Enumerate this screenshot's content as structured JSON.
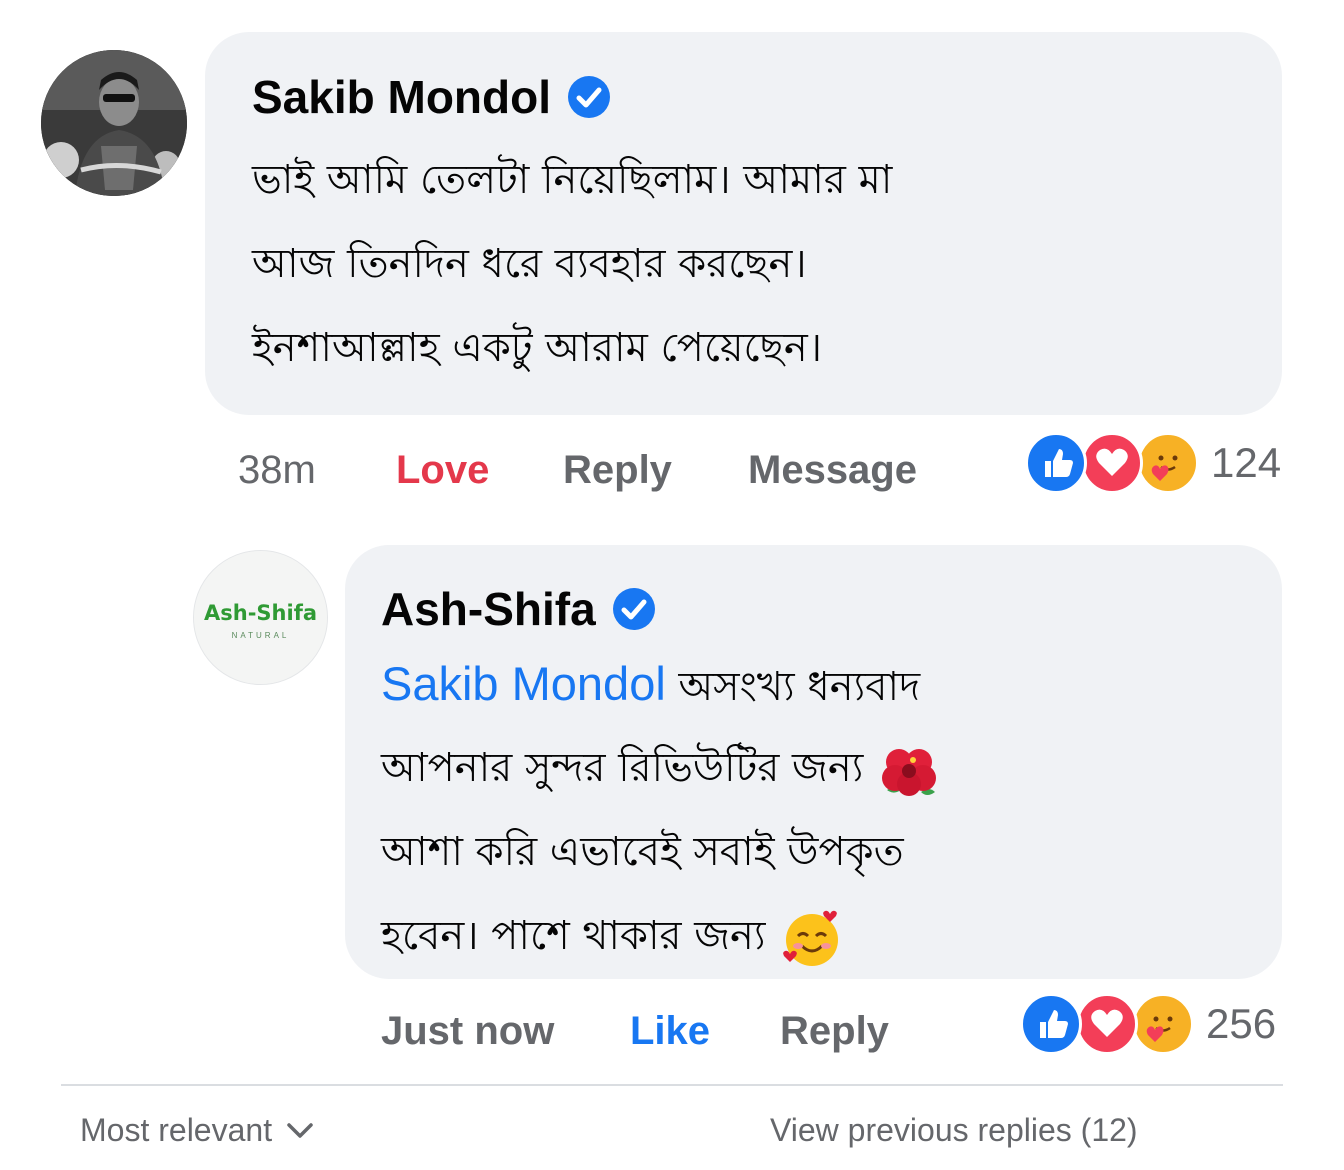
{
  "comment": {
    "author": "Sakib Mondol",
    "body_lines": [
      "ভাই আমি তেলটা নিয়েছিলাম। আমার মা",
      "আজ তিনদিন ধরে ব্যবহার করছেন।",
      "ইনশাআল্লাহ একটু আরাম পেয়েছেন।"
    ],
    "time": "38m",
    "love_label": "Love",
    "reply_label": "Reply",
    "message_label": "Message",
    "reaction_count": "124"
  },
  "reply": {
    "author": "Ash-Shifa",
    "avatar_logo": "Ash-Shifa",
    "avatar_sub": "NATURAL",
    "mention": "Sakib Mondol",
    "body_lines": [
      "অসংখ্য ধন্যবাদ",
      "আপনার সুন্দর রিভিউটির জন্য",
      "আশা করি এভাবেই সবাই উপকৃত",
      "হবেন। পাশে থাকার জন্য"
    ],
    "time": "Just now",
    "like_label": "Like",
    "reply_label": "Reply",
    "reaction_count": "256"
  },
  "footer": {
    "sort_label": "Most relevant",
    "view_previous": "View previous replies (12)"
  },
  "colors": {
    "accent_blue": "#1877f2",
    "love_red": "#e4384b",
    "bubble_bg": "#f0f2f5",
    "meta_gray": "#65676b"
  },
  "icons": [
    "verified-badge-icon",
    "like-reaction-icon",
    "love-reaction-icon",
    "care-reaction-icon",
    "hibiscus-emoji-icon",
    "smiling-hearts-emoji-icon",
    "chevron-down-icon"
  ]
}
